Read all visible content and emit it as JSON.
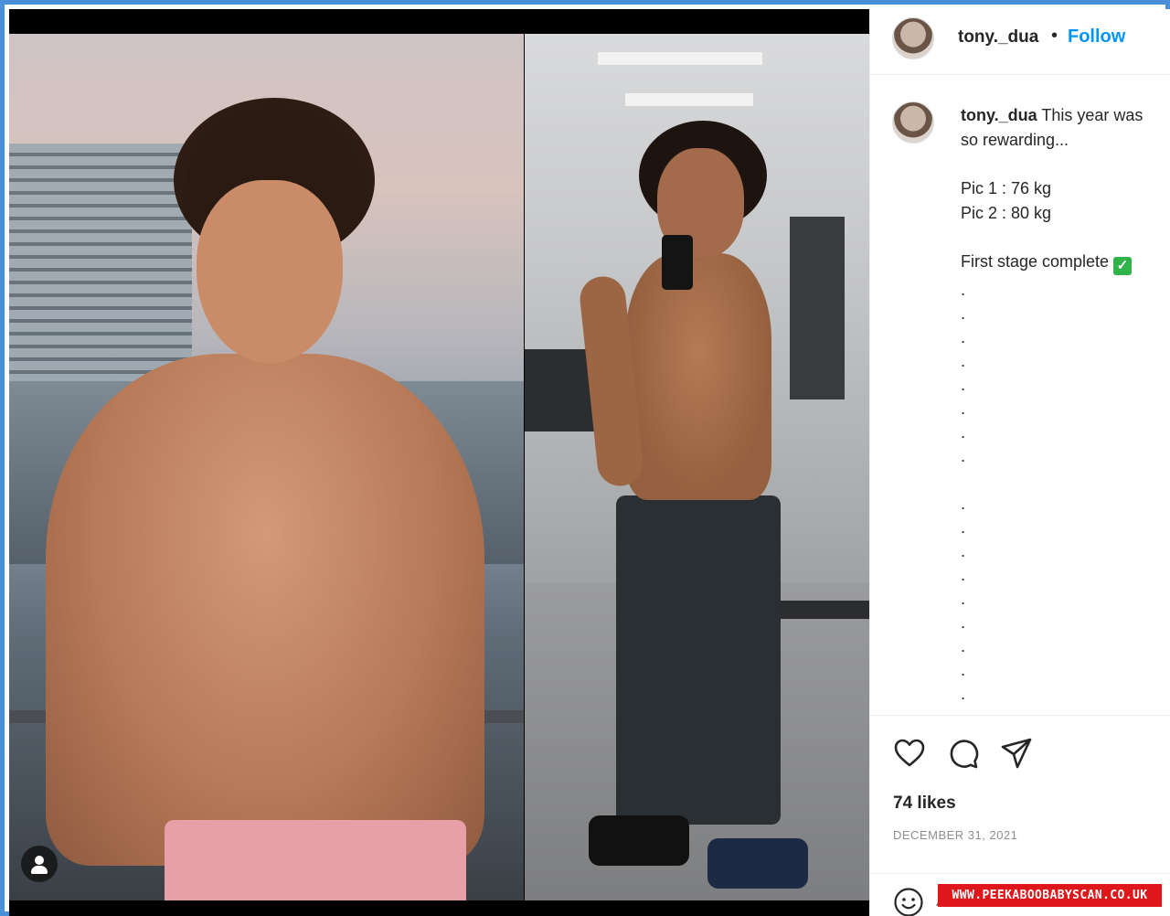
{
  "post": {
    "username": "tony._dua",
    "follow_label": "Follow",
    "separator": "•",
    "caption_intro": "This year was",
    "caption_cont": "so rewarding...",
    "pic1": "Pic 1 : 76 kg",
    "pic2": "Pic 2 : 80 kg",
    "stage": "First stage complete",
    "likes": "74 likes",
    "date": "DECEMBER 31, 2021",
    "comment_placeholder": "Add a comment..."
  },
  "icons": {
    "check": "✓",
    "like": "heart-icon",
    "comment": "comment-icon",
    "share": "share-icon",
    "emoji": "emoji-icon",
    "tag": "user-tag-icon"
  },
  "watermark": "WWW.PEEKABOOBABYSCAN.CO.UK",
  "colors": {
    "follow": "#0095f6",
    "check": "#2fb34a",
    "watermark_bg": "#e0171a",
    "frame": "#4a90d9"
  }
}
